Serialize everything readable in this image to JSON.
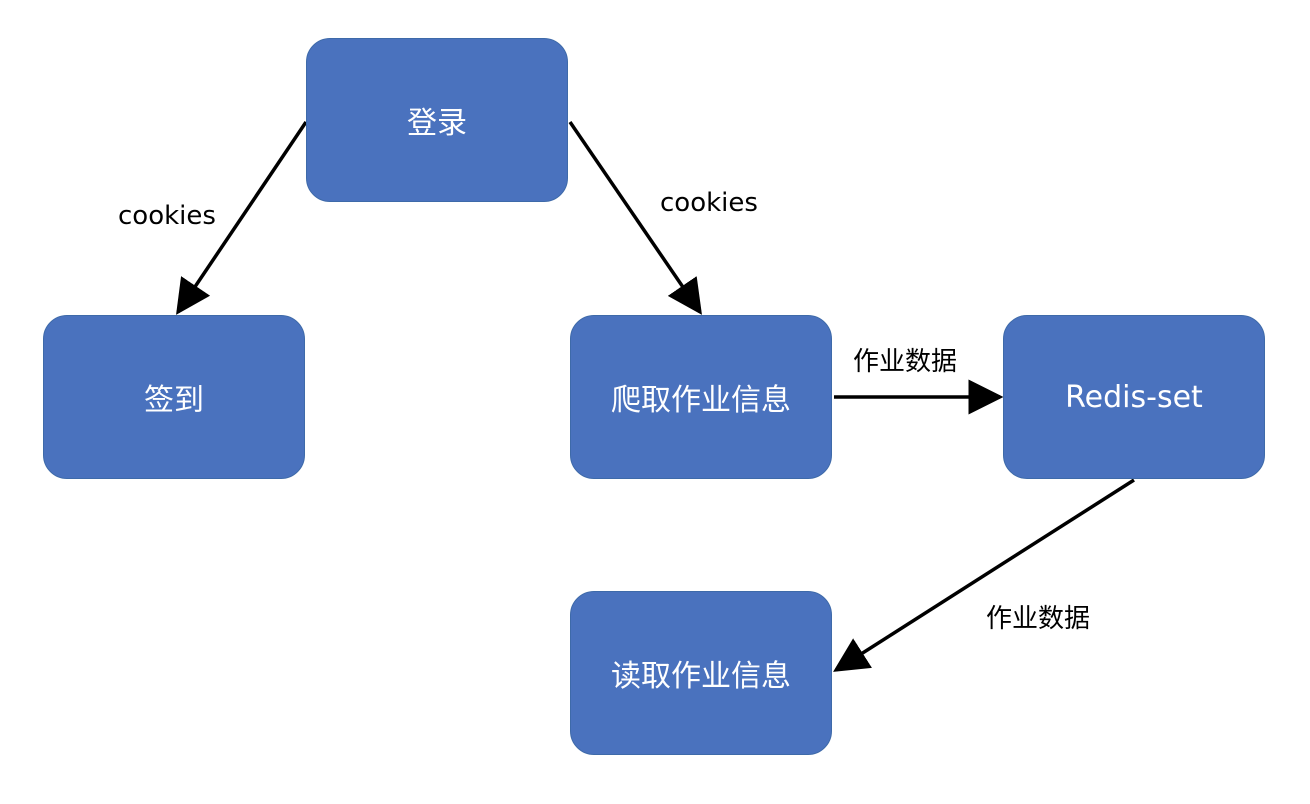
{
  "colors": {
    "node_fill": "#4a72be",
    "node_text": "#ffffff",
    "edge": "#000000"
  },
  "nodes": {
    "login": "登录",
    "sign_in": "签到",
    "crawl": "爬取作业信息",
    "redis": "Redis-set",
    "read": "读取作业信息"
  },
  "edges": {
    "login_to_sign_in": "cookies",
    "login_to_crawl": "cookies",
    "crawl_to_redis": "作业数据",
    "redis_to_read": "作业数据"
  }
}
